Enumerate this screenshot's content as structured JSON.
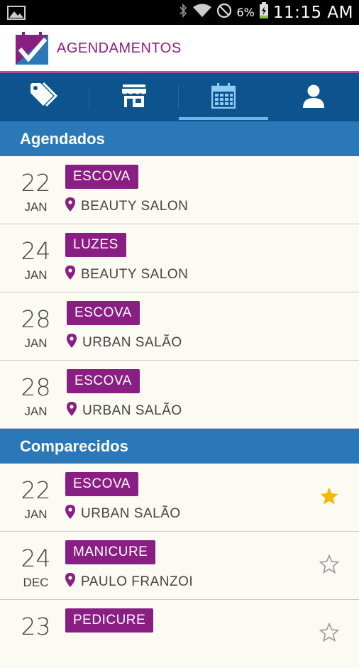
{
  "status_bar": {
    "battery_percent": "6%",
    "time": "11:15 AM",
    "icons": [
      "image-icon",
      "bluetooth-icon",
      "wifi-icon",
      "no-disturb-icon",
      "battery-charging-icon"
    ]
  },
  "app": {
    "title": "AGENDAMENTOS",
    "brand_color": "#8a1f83",
    "logo_icon": "check-calendar-logo"
  },
  "tabs": [
    {
      "icon": "tag-icon",
      "active": false
    },
    {
      "icon": "store-icon",
      "active": false
    },
    {
      "icon": "calendar-icon",
      "active": true
    },
    {
      "icon": "user-icon",
      "active": false
    }
  ],
  "sections": {
    "scheduled": {
      "label": "Agendados",
      "items": [
        {
          "day": "22",
          "month": "JAN",
          "service": "ESCOVA",
          "place": "BEAUTY SALON"
        },
        {
          "day": "24",
          "month": "JAN",
          "service": "LUZES",
          "place": "BEAUTY SALON"
        },
        {
          "day": "28",
          "month": "JAN",
          "service": "ESCOVA",
          "place": "URBAN SALÃO"
        },
        {
          "day": "28",
          "month": "JAN",
          "service": "ESCOVA",
          "place": "URBAN SALÃO"
        }
      ]
    },
    "attended": {
      "label": "Comparecidos",
      "items": [
        {
          "day": "22",
          "month": "JAN",
          "service": "ESCOVA",
          "place": "URBAN SALÃO",
          "favorite": true
        },
        {
          "day": "24",
          "month": "DEC",
          "service": "MANICURE",
          "place": "PAULO FRANZOI",
          "favorite": false
        },
        {
          "day": "23",
          "month": "",
          "service": "PEDICURE",
          "place": "",
          "favorite": false
        }
      ]
    }
  },
  "colors": {
    "tabbar": "#0d548e",
    "section_header": "#2a78b8",
    "service_badge": "#8a1f83",
    "star_active": "#f5b800",
    "star_inactive": "#9a9a9a"
  }
}
